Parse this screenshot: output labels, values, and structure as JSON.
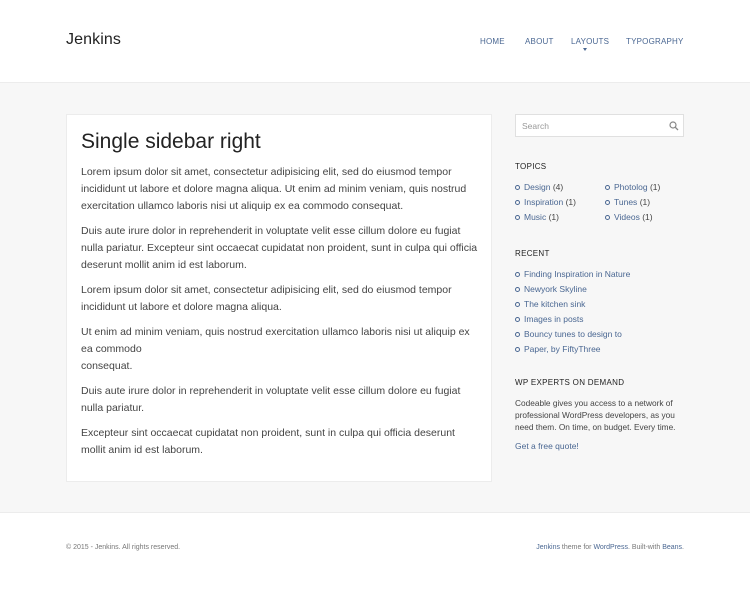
{
  "header": {
    "site_title": "Jenkins",
    "nav": [
      {
        "label": "HOME"
      },
      {
        "label": "ABOUT"
      },
      {
        "label": "LAYOUTS"
      },
      {
        "label": "TYPOGRAPHY"
      }
    ]
  },
  "main": {
    "title": "Single sidebar right",
    "paragraphs": [
      "Lorem ipsum dolor sit amet, consectetur adipisicing elit, sed do eiusmod tempor incididunt ut labore et dolore magna aliqua. Ut enim ad minim veniam, quis nostrud exercitation ullamco laboris nisi ut aliquip ex ea commodo consequat.",
      "Duis aute irure dolor in reprehenderit in voluptate velit esse cillum dolore eu fugiat nulla pariatur. Excepteur sint occaecat cupidatat non proident, sunt in culpa qui officia deserunt mollit anim id est laborum.",
      "Lorem ipsum dolor sit amet, consectetur adipisicing elit, sed do eiusmod tempor incididunt ut labore et dolore magna aliqua.",
      "Ut enim ad minim veniam, quis nostrud exercitation ullamco laboris nisi ut aliquip ex ea commodo",
      "consequat.",
      "Duis aute irure dolor in reprehenderit in voluptate velit esse cillum dolore eu fugiat nulla pariatur.",
      "Excepteur sint occaecat cupidatat non proident, sunt in culpa qui officia deserunt mollit anim id est laborum."
    ]
  },
  "sidebar": {
    "search": {
      "placeholder": "Search",
      "icon": "search-icon"
    },
    "topics": {
      "title": "TOPICS",
      "items": [
        {
          "label": "Design",
          "count": "(4)"
        },
        {
          "label": "Photolog",
          "count": "(1)"
        },
        {
          "label": "Inspiration",
          "count": "(1)"
        },
        {
          "label": "Tunes",
          "count": "(1)"
        },
        {
          "label": "Music",
          "count": "(1)"
        },
        {
          "label": "Videos",
          "count": "(1)"
        }
      ]
    },
    "recent": {
      "title": "RECENT",
      "items": [
        "Finding Inspiration in Nature",
        "Newyork Skyline",
        "The kitchen sink",
        "Images in posts",
        "Bouncy tunes to design to",
        "Paper, by FiftyThree"
      ]
    },
    "experts": {
      "title": "WP EXPERTS ON DEMAND",
      "description": "Codeable gives you access to a network of professional WordPress developers, as you need them. On time, on budget. Every time.",
      "link": "Get a free quote!"
    }
  },
  "footer": {
    "copyright": "© 2015 - Jenkins. All rights reserved.",
    "credit_theme": "Jenkins",
    "credit_text1": " theme for ",
    "credit_wp": "WordPress",
    "credit_text2": ". Built-with ",
    "credit_beans": "Beans",
    "credit_text3": "."
  },
  "colors": {
    "accent": "#4a6792",
    "background": "#f7f7f7",
    "card": "#ffffff"
  }
}
